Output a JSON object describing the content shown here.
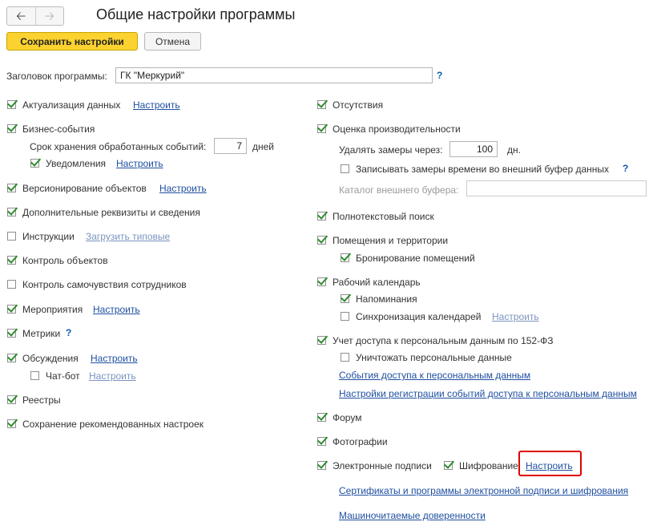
{
  "header": {
    "back_icon": "arrow-left-icon",
    "forward_icon": "arrow-right-icon",
    "title": "Общие настройки программы"
  },
  "toolbar": {
    "save_label": "Сохранить настройки",
    "cancel_label": "Отмена"
  },
  "app_title": {
    "label": "Заголовок программы:",
    "value": "ГК \"Меркурий\"",
    "help": "?"
  },
  "left": {
    "aktualizacia": {
      "label": "Актуализация данных",
      "link": "Настроить",
      "checked": true
    },
    "biznes": {
      "label": "Бизнес-события",
      "checked": true
    },
    "srok": {
      "label": "Срок хранения обработанных событий:",
      "value": "7",
      "unit": "дней"
    },
    "uvedomlenia": {
      "label": "Уведомления",
      "link": "Настроить",
      "checked": true
    },
    "versionirovanie": {
      "label": "Версионирование объектов",
      "link": "Настроить",
      "checked": true
    },
    "dop_rekvizity": {
      "label": "Дополнительные реквизиты и сведения",
      "checked": true
    },
    "instrukcii": {
      "label": "Инструкции",
      "link": "Загрузить типовые",
      "checked": false
    },
    "kontrol_obj": {
      "label": "Контроль объектов",
      "checked": true
    },
    "samochuvstvie": {
      "label": "Контроль самочувствия сотрудников",
      "checked": false
    },
    "meropriyatiya": {
      "label": "Мероприятия",
      "link": "Настроить",
      "checked": true
    },
    "metriki": {
      "label": "Метрики",
      "help": "?",
      "checked": true
    },
    "obsuzhdeniya": {
      "label": "Обсуждения",
      "link": "Настроить",
      "checked": true
    },
    "chatbot": {
      "label": "Чат-бот",
      "link": "Настроить",
      "checked": false
    },
    "reestry": {
      "label": "Реестры",
      "checked": true
    },
    "sohranenie": {
      "label": "Сохранение рекомендованных настроек",
      "checked": true
    }
  },
  "right": {
    "otsutstviya": {
      "label": "Отсутствия",
      "checked": true
    },
    "ocenka": {
      "label": "Оценка производительности",
      "checked": true
    },
    "udalyat": {
      "label": "Удалять замеры через:",
      "value": "100",
      "unit": "дн."
    },
    "zapisyvat": {
      "label": "Записывать замеры времени во внешний буфер данных",
      "help": "?",
      "checked": false
    },
    "katalog": {
      "label": "Каталог внешнего буфера:",
      "value": ""
    },
    "polnotekst": {
      "label": "Полнотекстовый поиск",
      "checked": true
    },
    "pomeshcheniya": {
      "label": "Помещения и территории",
      "checked": true
    },
    "bronirovanie": {
      "label": "Бронирование помещений",
      "checked": true
    },
    "kalendar": {
      "label": "Рабочий календарь",
      "checked": true
    },
    "napominaniya": {
      "label": "Напоминания",
      "checked": true
    },
    "sinhronizaciya": {
      "label": "Синхронизация календарей",
      "link": "Настроить",
      "checked": false
    },
    "uchet": {
      "label": "Учет доступа к персональным данным по 152-ФЗ",
      "checked": true
    },
    "unichtozhat": {
      "label": "Уничтожать персональные данные",
      "checked": false
    },
    "sobytiya_link": "События доступа к персональным данным",
    "nastroiki_link": "Настройки регистрации событий доступа к персональным данным",
    "forum": {
      "label": "Форум",
      "checked": true
    },
    "foto": {
      "label": "Фотографии",
      "checked": true
    },
    "ep": {
      "label": "Электронные подписи",
      "checked": true
    },
    "shifrovanie": {
      "label": "Шифрование",
      "link": "Настроить",
      "checked": true
    },
    "sertifikaty_link": "Сертификаты и программы электронной подписи и шифрования",
    "doverennosti_link": "Машиночитаемые доверенности"
  },
  "colors": {
    "primary_button": "#fbd22f",
    "link": "#1f4fa0",
    "check": "#2e8b2e",
    "highlight": "#e00000"
  }
}
